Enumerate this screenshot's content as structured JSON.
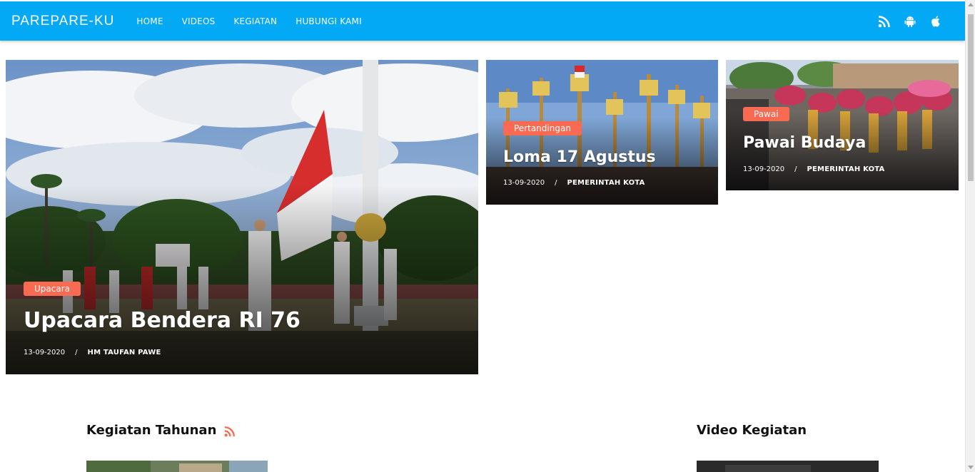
{
  "navbar": {
    "brand": "PAREPARE-KU",
    "menu": [
      "HOME",
      "VIDEOS",
      "KEGIATAN",
      "HUBUNGI KAMI"
    ],
    "icons": [
      "rss-icon",
      "android-icon",
      "apple-icon"
    ]
  },
  "featured": {
    "main": {
      "tag": "Upacara",
      "title": "Upacara Bendera RI 76",
      "date": "13-09-2020",
      "separator": "/",
      "author": "HM TAUFAN PAWE"
    },
    "side1": {
      "tag": "Pertandingan",
      "title": "Loma 17 Agustus",
      "date": "13-09-2020",
      "separator": "/",
      "author": "PEMERINTAH KOTA"
    },
    "side2": {
      "tag": "Pawai",
      "title": "Pawai Budaya",
      "date": "13-09-2020",
      "separator": "/",
      "author": "PEMERINTAH KOTA"
    }
  },
  "sections": {
    "annual": {
      "title": "Kegiatan Tahunan",
      "icon": "rss-icon"
    },
    "video": {
      "title": "Video Kegiatan"
    }
  },
  "colors": {
    "navbar": "#03a9f4",
    "tag": "#f96a52",
    "rss_accent": "#f96a52"
  }
}
